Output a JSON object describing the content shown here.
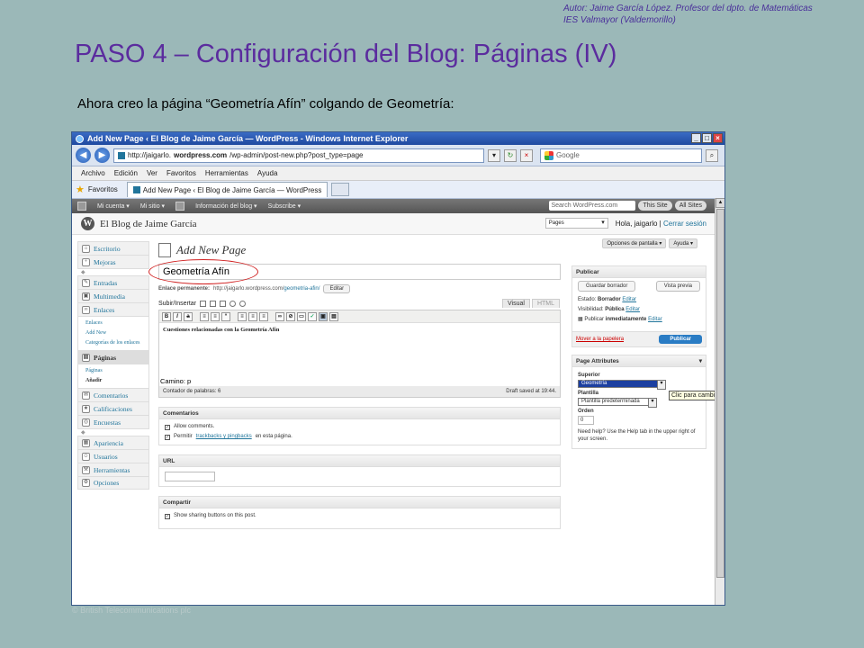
{
  "slide": {
    "author_line1": "Autor: Jaime García López. Profesor del dpto. de Matemáticas",
    "author_line2": "IES Valmayor (Valdemorillo)",
    "title": "PASO 4 – Configuración del Blog: Páginas (IV)",
    "subtitle": "Ahora creo la página “Geometría Afín” colgando de Geometría:",
    "footer": "© British Telecommunications plc"
  },
  "browser": {
    "window_title": "Add New Page ‹ El Blog de Jaime García — WordPress - Windows Internet Explorer",
    "url_prefix": "http://jaigarlo.",
    "url_bold": "wordpress.com",
    "url_suffix": "/wp-admin/post-new.php?post_type=page",
    "search_placeholder": "Google",
    "menu": [
      "Archivo",
      "Edición",
      "Ver",
      "Favoritos",
      "Herramientas",
      "Ayuda"
    ],
    "favorites_label": "Favoritos",
    "tab_title": "Add New Page ‹ El Blog de Jaime García — WordPress"
  },
  "wpbar": {
    "items": [
      "Mi cuenta ▾",
      "Mi sitio ▾",
      "Información del blog ▾",
      "Subscribe ▾"
    ],
    "search": "Search WordPress.com",
    "this_site": "This Site",
    "all_sites": "All Sites"
  },
  "wphead": {
    "blog_name": "El Blog de Jaime García",
    "pages_select": "Pages",
    "greeting": "Hola, jaigarlo",
    "logout": "Cerrar sesión",
    "screen_options": "Opciones de pantalla ▾",
    "help": "Ayuda ▾"
  },
  "menu": {
    "escritorio": "Escritorio",
    "mejoras": "Mejoras",
    "entradas": "Entradas",
    "multimedia": "Multimedia",
    "enlaces": "Enlaces",
    "enlaces_sub": [
      "Enlaces",
      "Add New",
      "Categorías de los enlaces"
    ],
    "paginas": "Páginas",
    "paginas_sub": [
      "Páginas",
      "Añadir"
    ],
    "comentarios": "Comentarios",
    "calificaciones": "Calificaciones",
    "encuestas": "Encuestas",
    "apariencia": "Apariencia",
    "usuarios": "Usuarios",
    "herramientas": "Herramientas",
    "opciones": "Opciones"
  },
  "editor": {
    "heading": "Add New Page",
    "title_value": "Geometría Afín",
    "permalink_label": "Enlace permanente:",
    "permalink_base": "http://jaigarlo.wordpress.com/",
    "permalink_slug": "geometria-afin/",
    "edit_btn": "Editar",
    "upload_label": "Subir/Insertar",
    "tab_visual": "Visual",
    "tab_html": "HTML",
    "body": "Cuestiones relacionadas con la Geometría Afín",
    "path": "Camino: p",
    "word_count": "Contador de palabras: 6",
    "draft_saved": "Draft saved at 19:44."
  },
  "comments_box": {
    "title": "Comentarios",
    "allow": "Allow comments.",
    "permit_prefix": "Permitir",
    "permit_link": "trackbacks y pingbacks",
    "permit_suffix": "en esta página."
  },
  "url_box": {
    "title": "URL"
  },
  "share_box": {
    "title": "Compartir",
    "show": "Show sharing buttons on this post."
  },
  "publish": {
    "title": "Publicar",
    "save_draft": "Guardar borrador",
    "preview": "Vista previa",
    "status_label": "Estado:",
    "status_value": "Borrador",
    "visibility_label": "Visibilidad:",
    "visibility_value": "Pública",
    "publish_label": "Publicar",
    "publish_value": "inmediatamente",
    "edit": "Editar",
    "trash": "Mover a la papelera",
    "publish_btn": "Publicar"
  },
  "attributes": {
    "title": "Page Attributes",
    "parent_label": "Superior",
    "parent_value": "Geometría",
    "template_label": "Plantilla",
    "template_value": "Plantilla predeterminada",
    "order_label": "Orden",
    "order_value": "0",
    "help": "Need help? Use the Help tab in the upper right of your screen.",
    "tooltip": "Clic para cambiar"
  }
}
